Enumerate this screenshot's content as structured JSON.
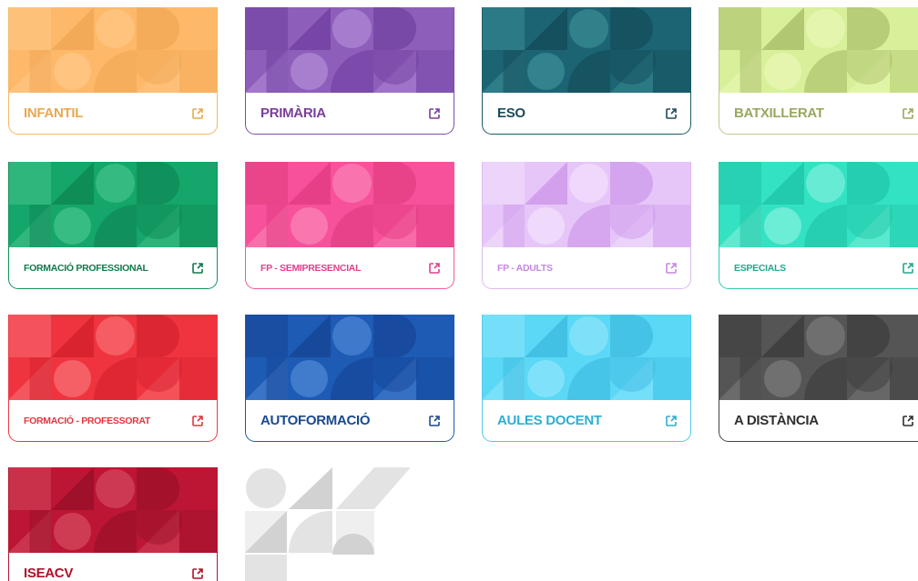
{
  "cards": [
    {
      "label": "INFANTIL",
      "text_color": "#E9A851",
      "border_color": "#F3B964",
      "base": "#FDB869",
      "shade": "#EFA653",
      "light": "#FFC888",
      "icon": "external-link-icon"
    },
    {
      "label": "PRIMÀRIA",
      "text_color": "#7A3E9B",
      "border_color": "#7D4BA6",
      "base": "#8E5EBB",
      "shade": "#6E3E9E",
      "light": "#B08AD6",
      "icon": "external-link-icon"
    },
    {
      "label": "ESO",
      "text_color": "#1E4A5A",
      "border_color": "#1C5A68",
      "base": "#1C6474",
      "shade": "#134A57",
      "light": "#3A8D96",
      "icon": "external-link-icon"
    },
    {
      "label": "BATXILLERAT",
      "text_color": "#98A85E",
      "border_color": "#B9C98A",
      "base": "#D7F099",
      "shade": "#A6BA66",
      "light": "#E9F7B6",
      "icon": "external-link-icon"
    },
    {
      "label": "FORMACIÓ PROFESSIONAL",
      "text_color": "#0F7A4A",
      "border_color": "#13925A",
      "base": "#14A66A",
      "shade": "#0E8451",
      "light": "#43C38C",
      "icon": "external-link-icon"
    },
    {
      "label": "FP - SEMIPRESENCIAL",
      "text_color": "#E0408E",
      "border_color": "#F05A9C",
      "base": "#F6519A",
      "shade": "#E03A80",
      "light": "#FB83B6",
      "icon": "external-link-icon"
    },
    {
      "label": "FP - ADULTS",
      "text_color": "#C686E4",
      "border_color": "#DDB8F2",
      "base": "#E6C6F8",
      "shade": "#CB93EA",
      "light": "#F2E0FC",
      "icon": "external-link-icon"
    },
    {
      "label": "ESPECIALS",
      "text_color": "#22A88E",
      "border_color": "#2EC9A8",
      "base": "#33E2C2",
      "shade": "#1EC3A4",
      "light": "#7FF0DC",
      "icon": "external-link-icon"
    },
    {
      "label": "FORMACIÓ - PROFESSORAT",
      "text_color": "#E2363C",
      "border_color": "#EC3A44",
      "base": "#F0343F",
      "shade": "#D21F2C",
      "light": "#F76E74",
      "icon": "external-link-icon"
    },
    {
      "label": "AUTOFORMACIÓ",
      "text_color": "#1A4A8E",
      "border_color": "#1D5AA8",
      "base": "#1D5BB5",
      "shade": "#154393",
      "light": "#4E86D4",
      "icon": "external-link-icon"
    },
    {
      "label": "AULES DOCENT",
      "text_color": "#2CAFD2",
      "border_color": "#4FCBEA",
      "base": "#5AD8F6",
      "shade": "#3BB9DF",
      "light": "#8DE6FB",
      "icon": "external-link-icon"
    },
    {
      "label": "A DISTÀNCIA",
      "text_color": "#2F2F2F",
      "border_color": "#444444",
      "base": "#555555",
      "shade": "#3A3A3A",
      "light": "#7A7A7A",
      "icon": "external-link-icon"
    },
    {
      "label": "ISEACV",
      "text_color": "#B0102A",
      "border_color": "#B11730",
      "base": "#BC1634",
      "shade": "#950F27",
      "light": "#D4495F",
      "icon": "external-link-icon"
    }
  ],
  "placeholder": {
    "base": "#E3E3E3",
    "shade": "#D2D2D2",
    "light": "#EFEFEF"
  }
}
